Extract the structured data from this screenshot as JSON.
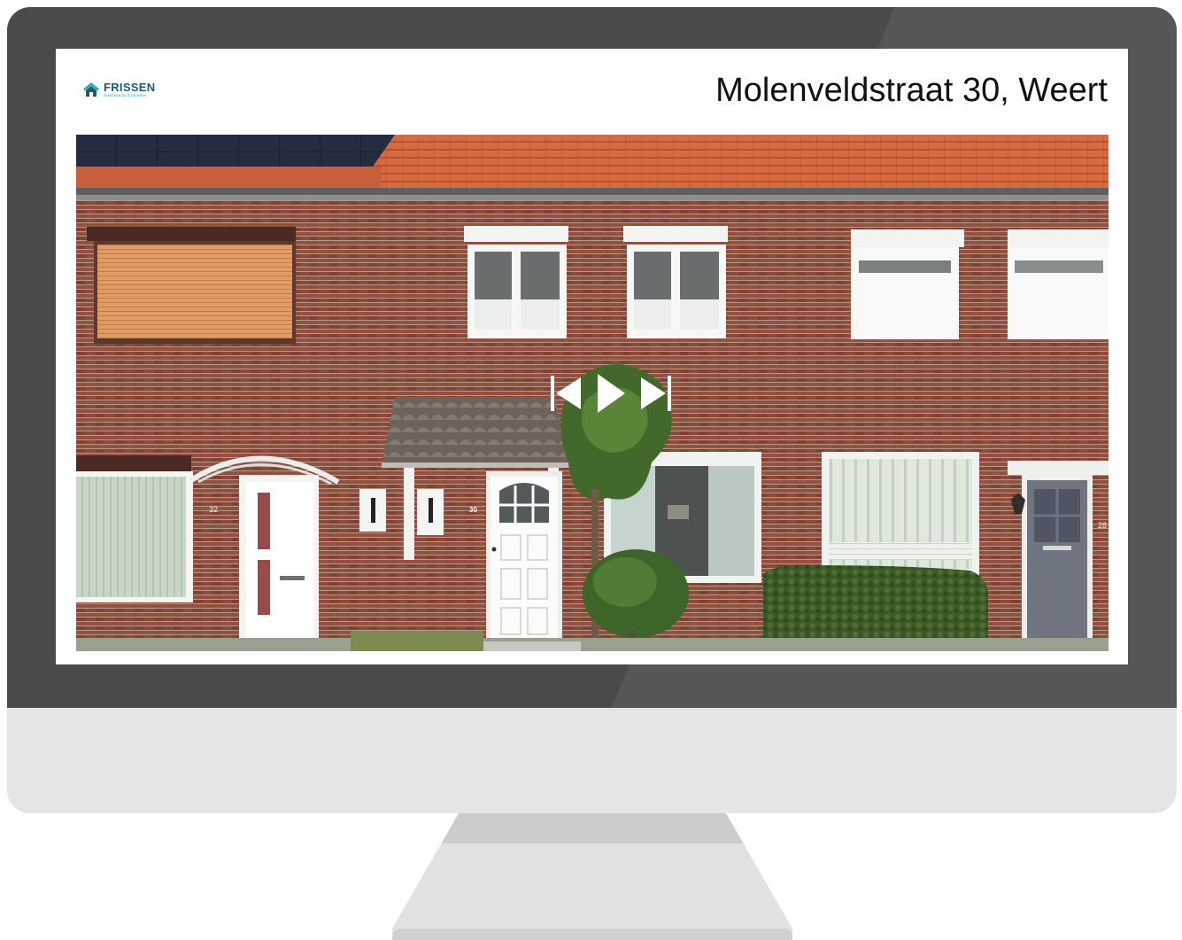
{
  "screen": {
    "brand": {
      "name": "FRISSEN",
      "tagline": "makelaardij & taxaties",
      "logo_icon": "house-icon",
      "color_primary": "#1f5b6a",
      "color_accent": "#22b3b8"
    },
    "listing_title": "Molenveldstraat 30, Weert",
    "photo": {
      "house_number_left": "32",
      "house_number_main": "30",
      "house_number_right": "28"
    },
    "controls": {
      "previous_icon": "skip-previous-icon",
      "play_icon": "play-icon",
      "next_icon": "skip-next-icon"
    }
  }
}
